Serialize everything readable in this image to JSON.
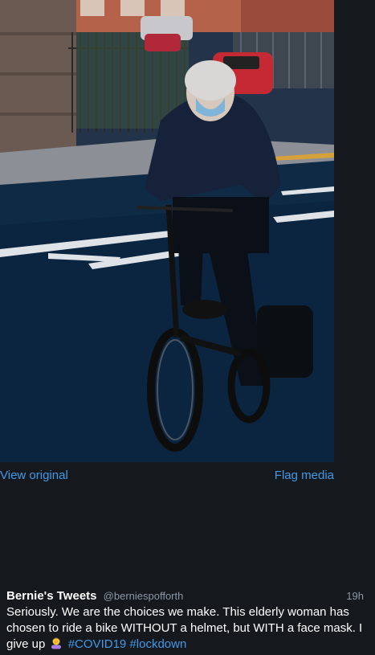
{
  "media": {
    "alt_icon": "bicycle-photo",
    "view_original_label": "View original",
    "flag_media_label": "Flag media"
  },
  "tweet": {
    "author": "Bernie's Tweets",
    "handle": "@berniespofforth",
    "time": "19h",
    "text": "Seriously. We are the choices we make. This elderly woman has chosen to ride a bike WITHOUT a helmet, but WITH a face mask. I give up",
    "emoji_icon": "person-facepalming-icon",
    "hashtags": [
      "#COVID19",
      "#lockdown"
    ]
  },
  "colors": {
    "background": "#15181c",
    "link": "#3d9be9",
    "muted": "#8b98a5"
  }
}
